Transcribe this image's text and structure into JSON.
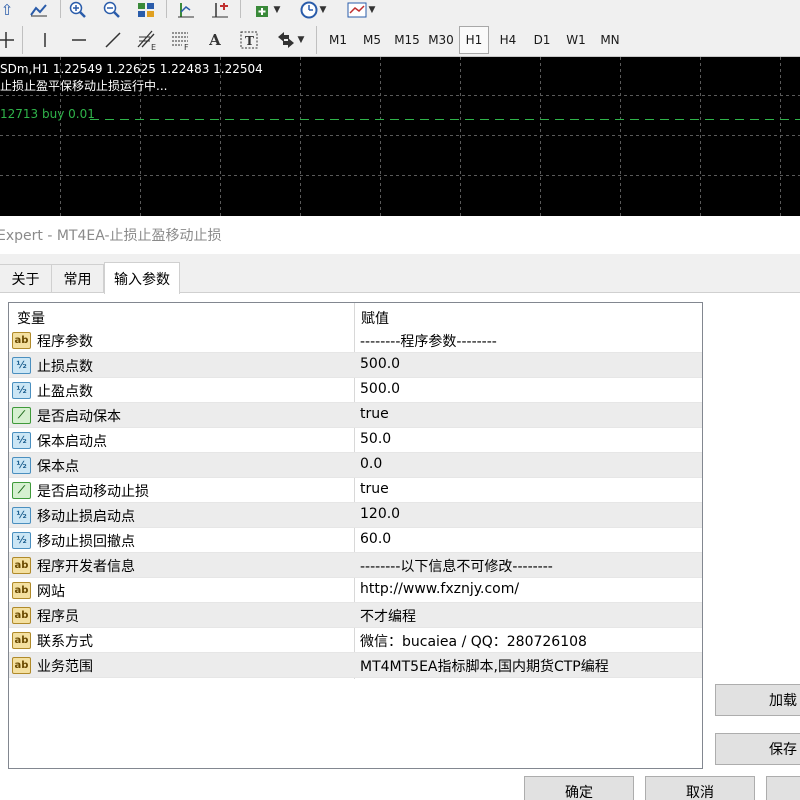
{
  "toolbar_top": {
    "icons": [
      "up-arrow-icon",
      "line-chart-icon",
      "zoom-in-icon",
      "zoom-out-icon",
      "tile-windows-icon",
      "period-sep-icon",
      "shift-chart-icon",
      "new-indicator-icon",
      "clock-icon",
      "templates-icon"
    ]
  },
  "toolbar": {
    "timeframes": [
      "M1",
      "M5",
      "M15",
      "M30",
      "H1",
      "H4",
      "D1",
      "W1",
      "MN"
    ],
    "active_timeframe": "H1",
    "tools": [
      "crosshair-icon",
      "vertical-line-icon",
      "horizontal-line-icon",
      "trendline-icon",
      "fibo-expansion-icon",
      "fibo-fan-icon",
      "text-icon",
      "text-label-icon",
      "arrows-icon"
    ],
    "text_tool_glyph": "A",
    "fibo_e": "E",
    "fibo_f": "F"
  },
  "chart": {
    "symbol_line": "SDm,H1  1.22549 1.22625 1.22483 1.22504",
    "ea_status": "止损止盈平保移动止损运行中...",
    "order_label": "12713 buy 0.01",
    "colors": {
      "background": "#000000",
      "grid": "#5a5a5a",
      "order_line": "#2fb34a"
    }
  },
  "dialog": {
    "title": "Expert - MT4EA-止损止盈移动止损",
    "tabs": [
      "关于",
      "常用",
      "输入参数"
    ],
    "active_tab": "输入参数",
    "columns": {
      "variable": "变量",
      "value": "赋值"
    },
    "params": [
      {
        "icon": "ab",
        "name": "程序参数",
        "value": "--------程序参数--------"
      },
      {
        "icon": "half",
        "name": "止损点数",
        "value": "500.0"
      },
      {
        "icon": "half",
        "name": "止盈点数",
        "value": "500.0"
      },
      {
        "icon": "bool",
        "name": "是否启动保本",
        "value": "true"
      },
      {
        "icon": "half",
        "name": "保本启动点",
        "value": "50.0"
      },
      {
        "icon": "half",
        "name": "保本点",
        "value": "0.0"
      },
      {
        "icon": "bool",
        "name": "是否启动移动止损",
        "value": "true"
      },
      {
        "icon": "half",
        "name": "移动止损启动点",
        "value": "120.0"
      },
      {
        "icon": "half",
        "name": "移动止损回撤点",
        "value": "60.0"
      },
      {
        "icon": "ab",
        "name": "程序开发者信息",
        "value": "--------以下信息不可修改--------"
      },
      {
        "icon": "ab",
        "name": "网站",
        "value": "http://www.fxznjy.com/"
      },
      {
        "icon": "ab",
        "name": "程序员",
        "value": "不才编程"
      },
      {
        "icon": "ab",
        "name": "联系方式",
        "value": "微信：bucaiea / QQ：280726108"
      },
      {
        "icon": "ab",
        "name": "业务范围",
        "value": "MT4MT5EA指标脚本,国内期货CTP编程"
      }
    ],
    "icon_glyphs": {
      "ab": "ab",
      "half": "½",
      "bool": "⟋"
    },
    "side_buttons": {
      "load": "加载",
      "save": "保存"
    },
    "bottom_buttons": {
      "ok": "确定",
      "cancel": "取消"
    }
  }
}
